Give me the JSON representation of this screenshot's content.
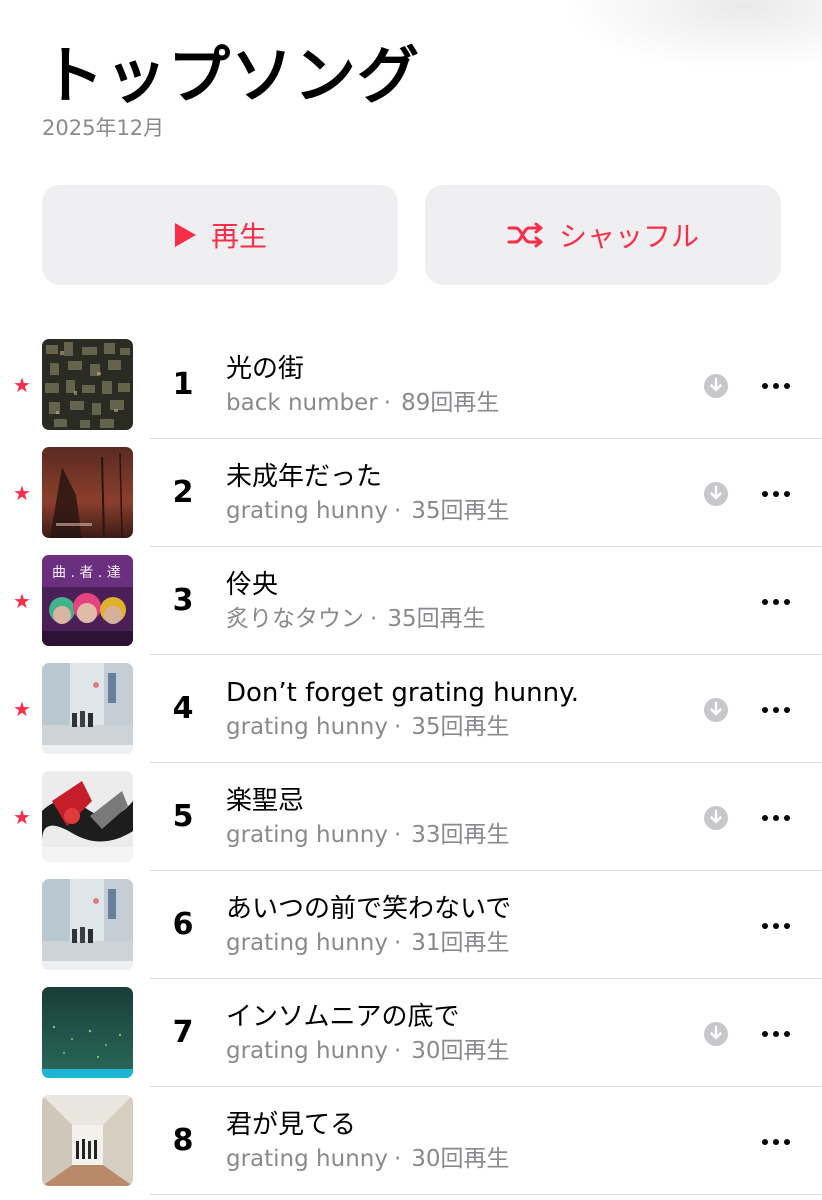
{
  "header": {
    "title": "トップソング",
    "subtitle": "2025年12月"
  },
  "actions": {
    "play_label": "再生",
    "shuffle_label": "シャッフル",
    "accent_color": "#fa2d48"
  },
  "songs": [
    {
      "rank": "1",
      "title": "光の街",
      "artist": "back number",
      "plays": "89回再生",
      "favorite": true,
      "downloaded": true,
      "art": "city-grid"
    },
    {
      "rank": "2",
      "title": "未成年だった",
      "artist": "grating hunny",
      "plays": "35回再生",
      "favorite": true,
      "downloaded": true,
      "art": "red-dusk"
    },
    {
      "rank": "3",
      "title": "伶央",
      "artist": "炙りなタウン",
      "plays": "35回再生",
      "favorite": true,
      "downloaded": false,
      "art": "three-faces"
    },
    {
      "rank": "4",
      "title": "Don’t forget grating hunny.",
      "artist": "grating hunny",
      "plays": "35回再生",
      "favorite": true,
      "downloaded": true,
      "art": "street-photo"
    },
    {
      "rank": "5",
      "title": "楽聖忌",
      "artist": "grating hunny",
      "plays": "33回再生",
      "favorite": true,
      "downloaded": true,
      "art": "abstract-red"
    },
    {
      "rank": "6",
      "title": "あいつの前で笑わないで",
      "artist": "grating hunny",
      "plays": "31回再生",
      "favorite": false,
      "downloaded": false,
      "art": "street-photo"
    },
    {
      "rank": "7",
      "title": "インソムニアの底で",
      "artist": "grating hunny",
      "plays": "30回再生",
      "favorite": false,
      "downloaded": true,
      "art": "teal-field"
    },
    {
      "rank": "8",
      "title": "君が見てる",
      "artist": "grating hunny",
      "plays": "30回再生",
      "favorite": false,
      "downloaded": false,
      "art": "hallway"
    }
  ],
  "icons": {
    "favorite": "star-icon",
    "download": "download-icon",
    "more": "more-icon",
    "play": "play-icon",
    "shuffle": "shuffle-icon"
  }
}
